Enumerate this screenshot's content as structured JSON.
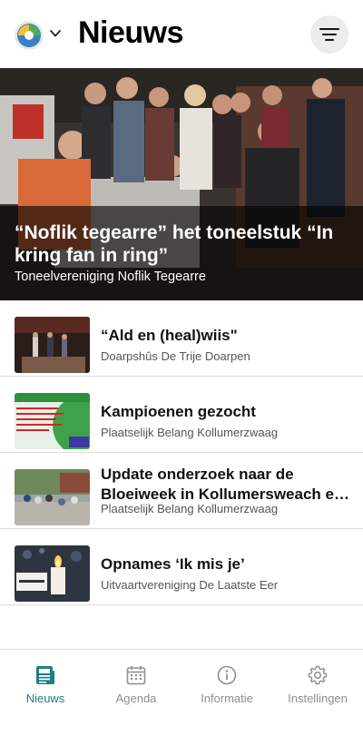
{
  "header": {
    "title": "Nieuws"
  },
  "hero": {
    "title": "“Noflik tegearre” het toneelstuk “In kring fan in ring”",
    "subtitle": "Toneelvereniging Noflik Tegearre"
  },
  "news": [
    {
      "title": "“Ald en (heal)wiis\"",
      "source": "Doarpshûs De Trije Doarpen"
    },
    {
      "title": "Kampioenen gezocht",
      "source": "Plaatselijk Belang Kollumerzwaag"
    },
    {
      "title_line1": "Update onderzoek naar de",
      "title_line2": "Bloeiweek in Kollumersweach en...",
      "source": "Plaatselijk Belang Kollumerzwaag"
    },
    {
      "title": "Opnames ‘Ik mis je’",
      "source": "Uitvaartvereniging De Laatste Eer"
    }
  ],
  "tabs": [
    {
      "label": "Nieuws",
      "icon": "newspaper-icon",
      "active": true
    },
    {
      "label": "Agenda",
      "icon": "calendar-icon",
      "active": false
    },
    {
      "label": "Informatie",
      "icon": "info-icon",
      "active": false
    },
    {
      "label": "Instellingen",
      "icon": "gear-icon",
      "active": false
    }
  ],
  "colors": {
    "accent": "#1d7f86",
    "inactive": "#8e8e93"
  }
}
